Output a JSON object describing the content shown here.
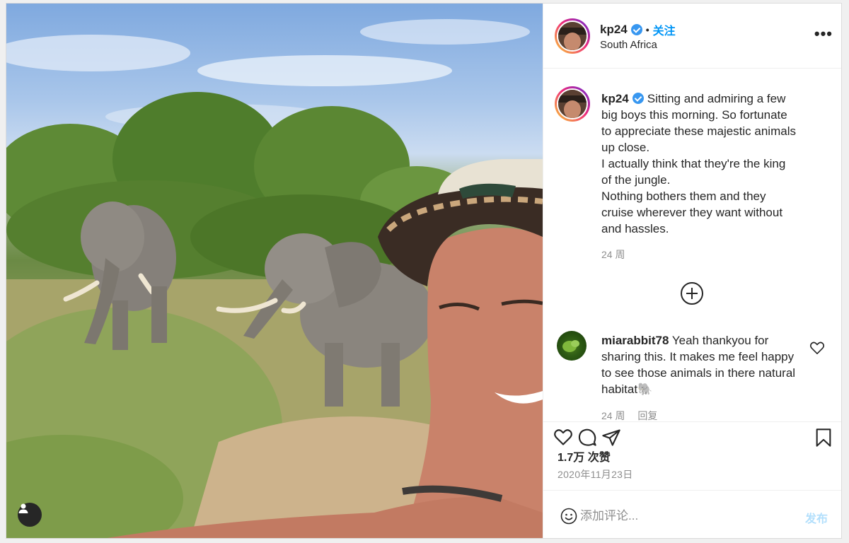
{
  "header": {
    "username": "kp24",
    "follow_label": "关注",
    "location": "South Africa",
    "more_label": "•••"
  },
  "caption": {
    "username": "kp24",
    "lines": [
      "Sitting and admiring a few",
      "big boys this morning. So fortunate",
      "to appreciate these majestic animals",
      "up close.",
      "I actually think that they're the king",
      "of the jungle.",
      "Nothing bothers them and they",
      "cruise wherever they want without",
      "and hassles."
    ],
    "time": "24 周"
  },
  "comment": {
    "username": "miarabbit78",
    "text": "Yeah thankyou for sharing this. It makes me feel happy to see those animals in there natural habitat🐘",
    "time": "24 周",
    "reply_label": "回复"
  },
  "actions": {
    "likes": "1.7万 次赞",
    "date": "2020年11月23日"
  },
  "add_comment": {
    "placeholder": "添加评论...",
    "post_label": "发布"
  },
  "colors": {
    "accent": "#0095f6",
    "verified": "#3897f0",
    "muted": "#8e8e8e",
    "post_disabled": "#b2dffc"
  },
  "icons": [
    "user-tag-icon",
    "verified-badge-icon",
    "more-options-icon",
    "load-more-icon",
    "heart-icon",
    "comment-icon",
    "share-icon",
    "bookmark-icon",
    "emoji-icon"
  ]
}
